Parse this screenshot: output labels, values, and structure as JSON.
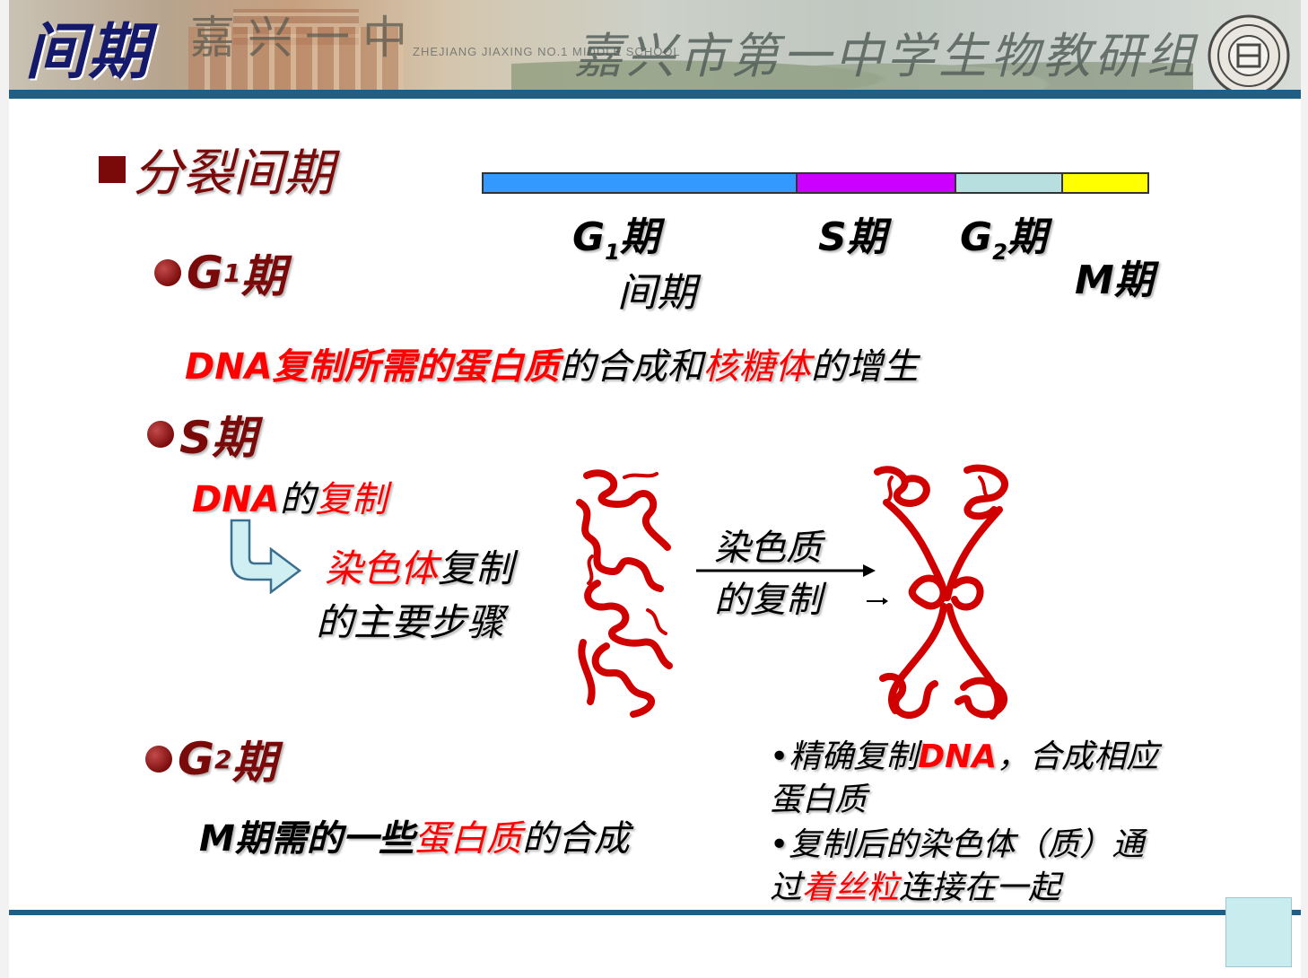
{
  "header": {
    "title": "间期",
    "school_name_old": "嘉兴一中",
    "school_name_english": "ZHEJIANG JIAXING NO.1 MIDDLE SCHOOL",
    "school_group": "嘉兴市第一中学生物教研组",
    "seal_icon": "school-seal-icon"
  },
  "section": {
    "title": "分裂间期"
  },
  "cycle_bar": {
    "colors": {
      "g1": "#3399ff",
      "s": "#cc00ff",
      "g2": "#b8dfe0",
      "m": "#ffff00"
    },
    "fractions": {
      "g1": 0.47,
      "s": 0.24,
      "g2": 0.16,
      "m": 0.13
    },
    "labels": {
      "g1_main": "G",
      "g1_sub": "1",
      "g1_suffix": "期",
      "s": "S期",
      "g2_main": "G",
      "g2_sub": "2",
      "g2_suffix": "期",
      "m": "M期",
      "interphase": "间期"
    }
  },
  "phases": {
    "g1": {
      "heading_main": "G",
      "heading_sub": "1",
      "heading_suffix": "期",
      "desc_part1": "DNA复制所需的蛋白质",
      "desc_part2": "的合成和",
      "desc_part3": "核糖体",
      "desc_part4": "的增生"
    },
    "s": {
      "heading": "S期",
      "desc_part1": "DNA",
      "desc_part2": "的",
      "desc_part3": "复制",
      "steps_part1": "染色体",
      "steps_part2": "复制",
      "steps_line2": "的主要步骤",
      "arrow_label_line1": "染色质",
      "arrow_label_line2": "的复制"
    },
    "g2": {
      "heading_main": "G",
      "heading_sub": "2",
      "heading_suffix": "期",
      "desc_part1": "M期需的一些",
      "desc_part2": "蛋白质",
      "desc_part3": "的合成"
    }
  },
  "notes": {
    "bullet": "•",
    "n1_part1": "精确复制",
    "n1_part2": "DNA",
    "n1_part3": "，合成相应",
    "n1_part4": "蛋白质",
    "n2_part1": "复制后的染色体（质）通",
    "n2_part2": "过",
    "n2_part3": "着丝粒",
    "n2_part4": "连接在一起"
  }
}
